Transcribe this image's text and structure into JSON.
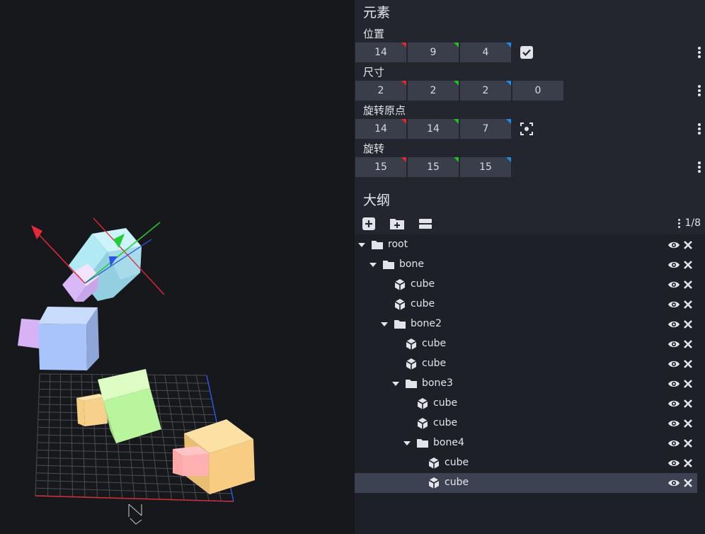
{
  "colors": {
    "axis_x": "#e52929",
    "axis_y": "#1fc01f",
    "axis_z": "#1a8cf0",
    "panel_bg": "#23262e",
    "input_bg": "#3a3e4b",
    "selected_row": "#3d4253"
  },
  "element": {
    "title": "元素",
    "position": {
      "label": "位置",
      "x": "14",
      "y": "9",
      "z": "4",
      "icon": "checkbox-checked-icon"
    },
    "size": {
      "label": "尺寸",
      "x": "2",
      "y": "2",
      "z": "2",
      "inflate": "0"
    },
    "pivot": {
      "label": "旋转原点",
      "x": "14",
      "y": "14",
      "z": "7",
      "icon": "focus-center-icon"
    },
    "rotation": {
      "label": "旋转",
      "x": "15",
      "y": "15",
      "z": "15"
    }
  },
  "outline": {
    "title": "大纲",
    "toolbar": {
      "add_cube_icon": "add-cube-icon",
      "add_group_icon": "add-folder-icon",
      "collapse_icon": "collapse-icon",
      "count": "1/8"
    },
    "nodes": [
      {
        "label": "root",
        "type": "group",
        "depth": 0,
        "expanded": true,
        "selected": false
      },
      {
        "label": "bone",
        "type": "group",
        "depth": 1,
        "expanded": true,
        "selected": false
      },
      {
        "label": "cube",
        "type": "cube",
        "depth": 2,
        "selected": false
      },
      {
        "label": "cube",
        "type": "cube",
        "depth": 2,
        "selected": false
      },
      {
        "label": "bone2",
        "type": "group",
        "depth": 2,
        "expanded": true,
        "selected": false
      },
      {
        "label": "cube",
        "type": "cube",
        "depth": 3,
        "selected": false
      },
      {
        "label": "cube",
        "type": "cube",
        "depth": 3,
        "selected": false
      },
      {
        "label": "bone3",
        "type": "group",
        "depth": 3,
        "expanded": true,
        "selected": false
      },
      {
        "label": "cube",
        "type": "cube",
        "depth": 4,
        "selected": false
      },
      {
        "label": "cube",
        "type": "cube",
        "depth": 4,
        "selected": false
      },
      {
        "label": "bone4",
        "type": "group",
        "depth": 4,
        "expanded": true,
        "selected": false
      },
      {
        "label": "cube",
        "type": "cube",
        "depth": 5,
        "selected": false
      },
      {
        "label": "cube",
        "type": "cube",
        "depth": 5,
        "selected": true
      }
    ]
  },
  "viewport": {
    "compass_label": "N"
  }
}
